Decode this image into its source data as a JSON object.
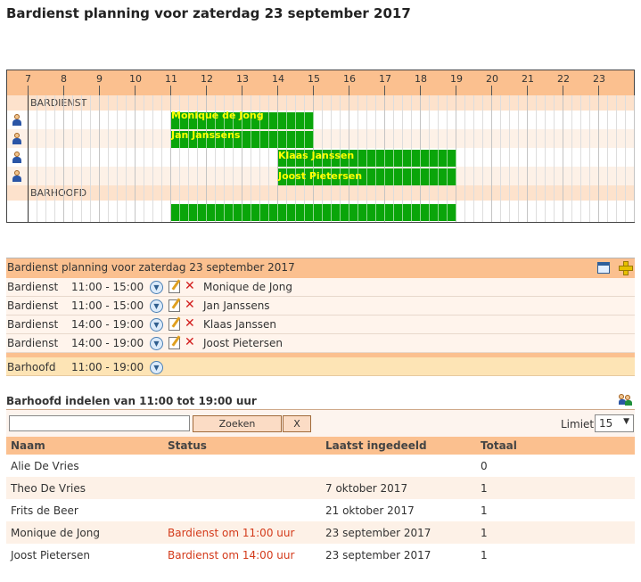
{
  "page_title": "Bardienst planning voor zaterdag 23 september 2017",
  "gantt": {
    "hours": [
      "7",
      "8",
      "9",
      "10",
      "11",
      "12",
      "13",
      "14",
      "15",
      "16",
      "17",
      "18",
      "19",
      "20",
      "21",
      "22",
      "23"
    ],
    "sections": [
      {
        "label": "BARDIENST"
      },
      {
        "label": "BARHOOFD"
      }
    ],
    "rows": [
      {
        "name": "Monique de Jong",
        "start": "11:00",
        "end": "15:00"
      },
      {
        "name": "Jan Janssens",
        "start": "11:00",
        "end": "15:00"
      },
      {
        "name": "Klaas Janssen",
        "start": "14:00",
        "end": "19:00"
      },
      {
        "name": "Joost Pietersen",
        "start": "14:00",
        "end": "19:00"
      }
    ],
    "barhoofd": {
      "start": "11:00",
      "end": "19:00"
    },
    "colors": {
      "header": "#fbc08f",
      "bar": "#0aa50a",
      "label": "#ffff00"
    }
  },
  "planning": {
    "title": "Bardienst planning voor zaterdag 23 september 2017",
    "icons": [
      "calendar-icon",
      "add-icon"
    ],
    "rows": [
      {
        "role": "Bardienst",
        "time": "11:00 - 15:00",
        "name": "Monique de Jong"
      },
      {
        "role": "Bardienst",
        "time": "11:00 - 15:00",
        "name": "Jan Janssens"
      },
      {
        "role": "Bardienst",
        "time": "14:00 - 19:00",
        "name": "Klaas Janssen"
      },
      {
        "role": "Bardienst",
        "time": "14:00 - 19:00",
        "name": "Joost Pietersen"
      }
    ],
    "highlight": {
      "role": "Barhoofd",
      "time": "11:00 - 19:00"
    }
  },
  "assign": {
    "title": "Barhoofd indelen van 11:00 tot 19:00 uur",
    "search_value": "",
    "search_button": "Zoeken",
    "clear_button": "X",
    "limit_label": "Limiet",
    "limit_value": "15",
    "columns": [
      "Naam",
      "Status",
      "Laatst ingedeeld",
      "Totaal"
    ],
    "rows": [
      {
        "name": "Alie De Vries",
        "status": "",
        "last": "",
        "total": "0"
      },
      {
        "name": "Theo De Vries",
        "status": "",
        "last": "7 oktober 2017",
        "total": "1"
      },
      {
        "name": "Frits de Beer",
        "status": "",
        "last": "21 oktober 2017",
        "total": "1"
      },
      {
        "name": "Monique de Jong",
        "status": "Bardienst om 11:00 uur",
        "last": "23 september 2017",
        "total": "1"
      },
      {
        "name": "Joost Pietersen",
        "status": "Bardienst om 14:00 uur",
        "last": "23 september 2017",
        "total": "1"
      }
    ]
  }
}
